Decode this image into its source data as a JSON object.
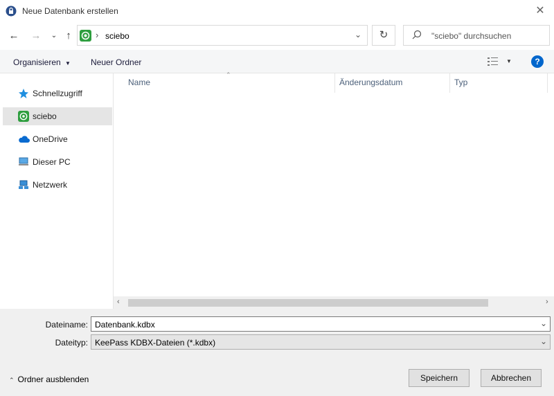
{
  "window": {
    "title": "Neue Datenbank erstellen"
  },
  "nav": {
    "back_icon": "arrow-left-icon",
    "forward_icon": "arrow-right-icon",
    "recent_icon": "chevron-down-icon",
    "up_icon": "arrow-up-icon",
    "breadcrumb_sep": "›",
    "current_folder": "sciebo",
    "search_placeholder": "\"sciebo\" durchsuchen"
  },
  "toolbar": {
    "organize_label": "Organisieren",
    "new_folder_label": "Neuer Ordner",
    "help_label": "?"
  },
  "sidebar": {
    "items": [
      {
        "label": "Schnellzugriff",
        "icon": "star-icon"
      },
      {
        "label": "sciebo",
        "icon": "sciebo-icon",
        "selected": true
      },
      {
        "label": "OneDrive",
        "icon": "cloud-icon"
      },
      {
        "label": "Dieser PC",
        "icon": "computer-icon"
      },
      {
        "label": "Netzwerk",
        "icon": "network-icon"
      }
    ]
  },
  "filelist": {
    "columns": [
      "Name",
      "Änderungsdatum",
      "Typ"
    ]
  },
  "form": {
    "filename_label": "Dateiname:",
    "filename_value": "Datenbank.kdbx",
    "filetype_label": "Dateityp:",
    "filetype_value": "KeePass KDBX-Dateien (*.kdbx)"
  },
  "footer": {
    "hide_folders_label": "Ordner ausblenden",
    "save_label": "Speichern",
    "cancel_label": "Abbrechen"
  },
  "colors": {
    "accent": "#0078d7",
    "sciebo_green": "#2e9e3f",
    "help_blue": "#0066cc"
  }
}
